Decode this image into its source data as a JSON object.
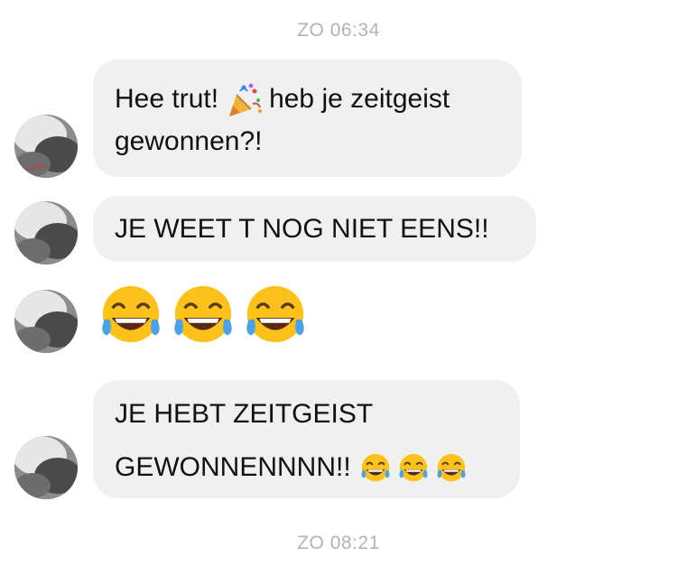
{
  "timestamps": {
    "top": "ZO 06:34",
    "bottom": "ZO 08:21"
  },
  "messages": [
    {
      "line1_before": "Hee trut!",
      "line1_after": "heb je zeitgeist",
      "line2": "gewonnen?!",
      "emoji": "party-popper-icon"
    },
    {
      "text": "JE WEET T NOG NIET EENS!!"
    },
    {
      "emoji": "tears-of-joy-icon",
      "count": 3
    },
    {
      "line1": "JE HEBT ZEITGEIST",
      "line2": "GEWONNENNNN!!",
      "emoji": "tears-of-joy-icon",
      "count": 3
    }
  ],
  "colors": {
    "bubble": "#f0f0f0",
    "timestamp": "#b3b3b3",
    "text": "#111111"
  }
}
